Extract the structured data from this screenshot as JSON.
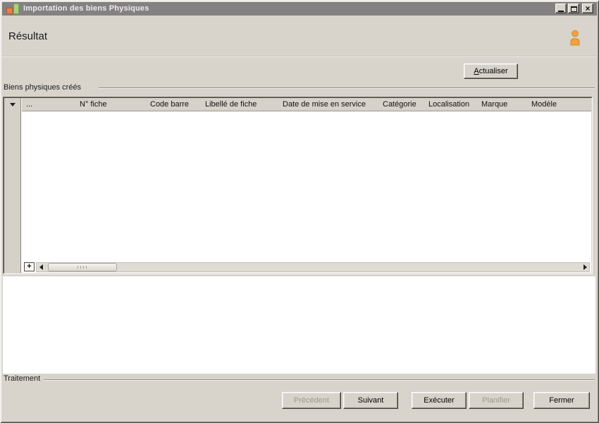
{
  "window": {
    "title": "Importation des biens Physiques",
    "controls": {
      "close_glyph": "×"
    }
  },
  "icons": {
    "app": "app-icon (orange and green bars)",
    "minimize": "minimize-icon",
    "maximize": "maximize-icon",
    "close": "close-icon",
    "person": "person-icon (orange user silhouette)",
    "column_selector": "chevron-down-icon",
    "scroll_left": "scroll-left-icon",
    "scroll_right": "scroll-right-icon"
  },
  "header": {
    "title": "Résultat"
  },
  "toolbar": {
    "refresh_accesskey": "A",
    "refresh_rest": "ctualiser",
    "refresh_label": "Actualiser"
  },
  "results_group": {
    "label": "Biens physiques créés"
  },
  "grid": {
    "columns": [
      "...",
      "N° fiche",
      "Code barre",
      "Libellé de fiche",
      "Date de mise en service",
      "Catégorie",
      "Localisation",
      "Marque",
      "Modèle"
    ],
    "rows": [],
    "add_button_label": "+"
  },
  "status": {
    "label": "Traitement"
  },
  "footer": {
    "buttons": [
      {
        "label": "Précédent",
        "enabled": false
      },
      {
        "label": "Suivant",
        "enabled": true
      },
      {
        "label": "Exécuter",
        "enabled": true
      },
      {
        "label": "Planifier",
        "enabled": false
      },
      {
        "label": "Fermer",
        "enabled": true
      }
    ]
  },
  "colors": {
    "titlebar": "#838181",
    "window_bg": "#d8d4cc",
    "grid_header_bg": "#d6d2c9",
    "grid_body_bg": "#ffffff",
    "accent_orange": "#f3a23a",
    "app_icon_orange": "#ec7f4b",
    "app_icon_green": "#a8d17e",
    "disabled_text": "#9c9990"
  }
}
